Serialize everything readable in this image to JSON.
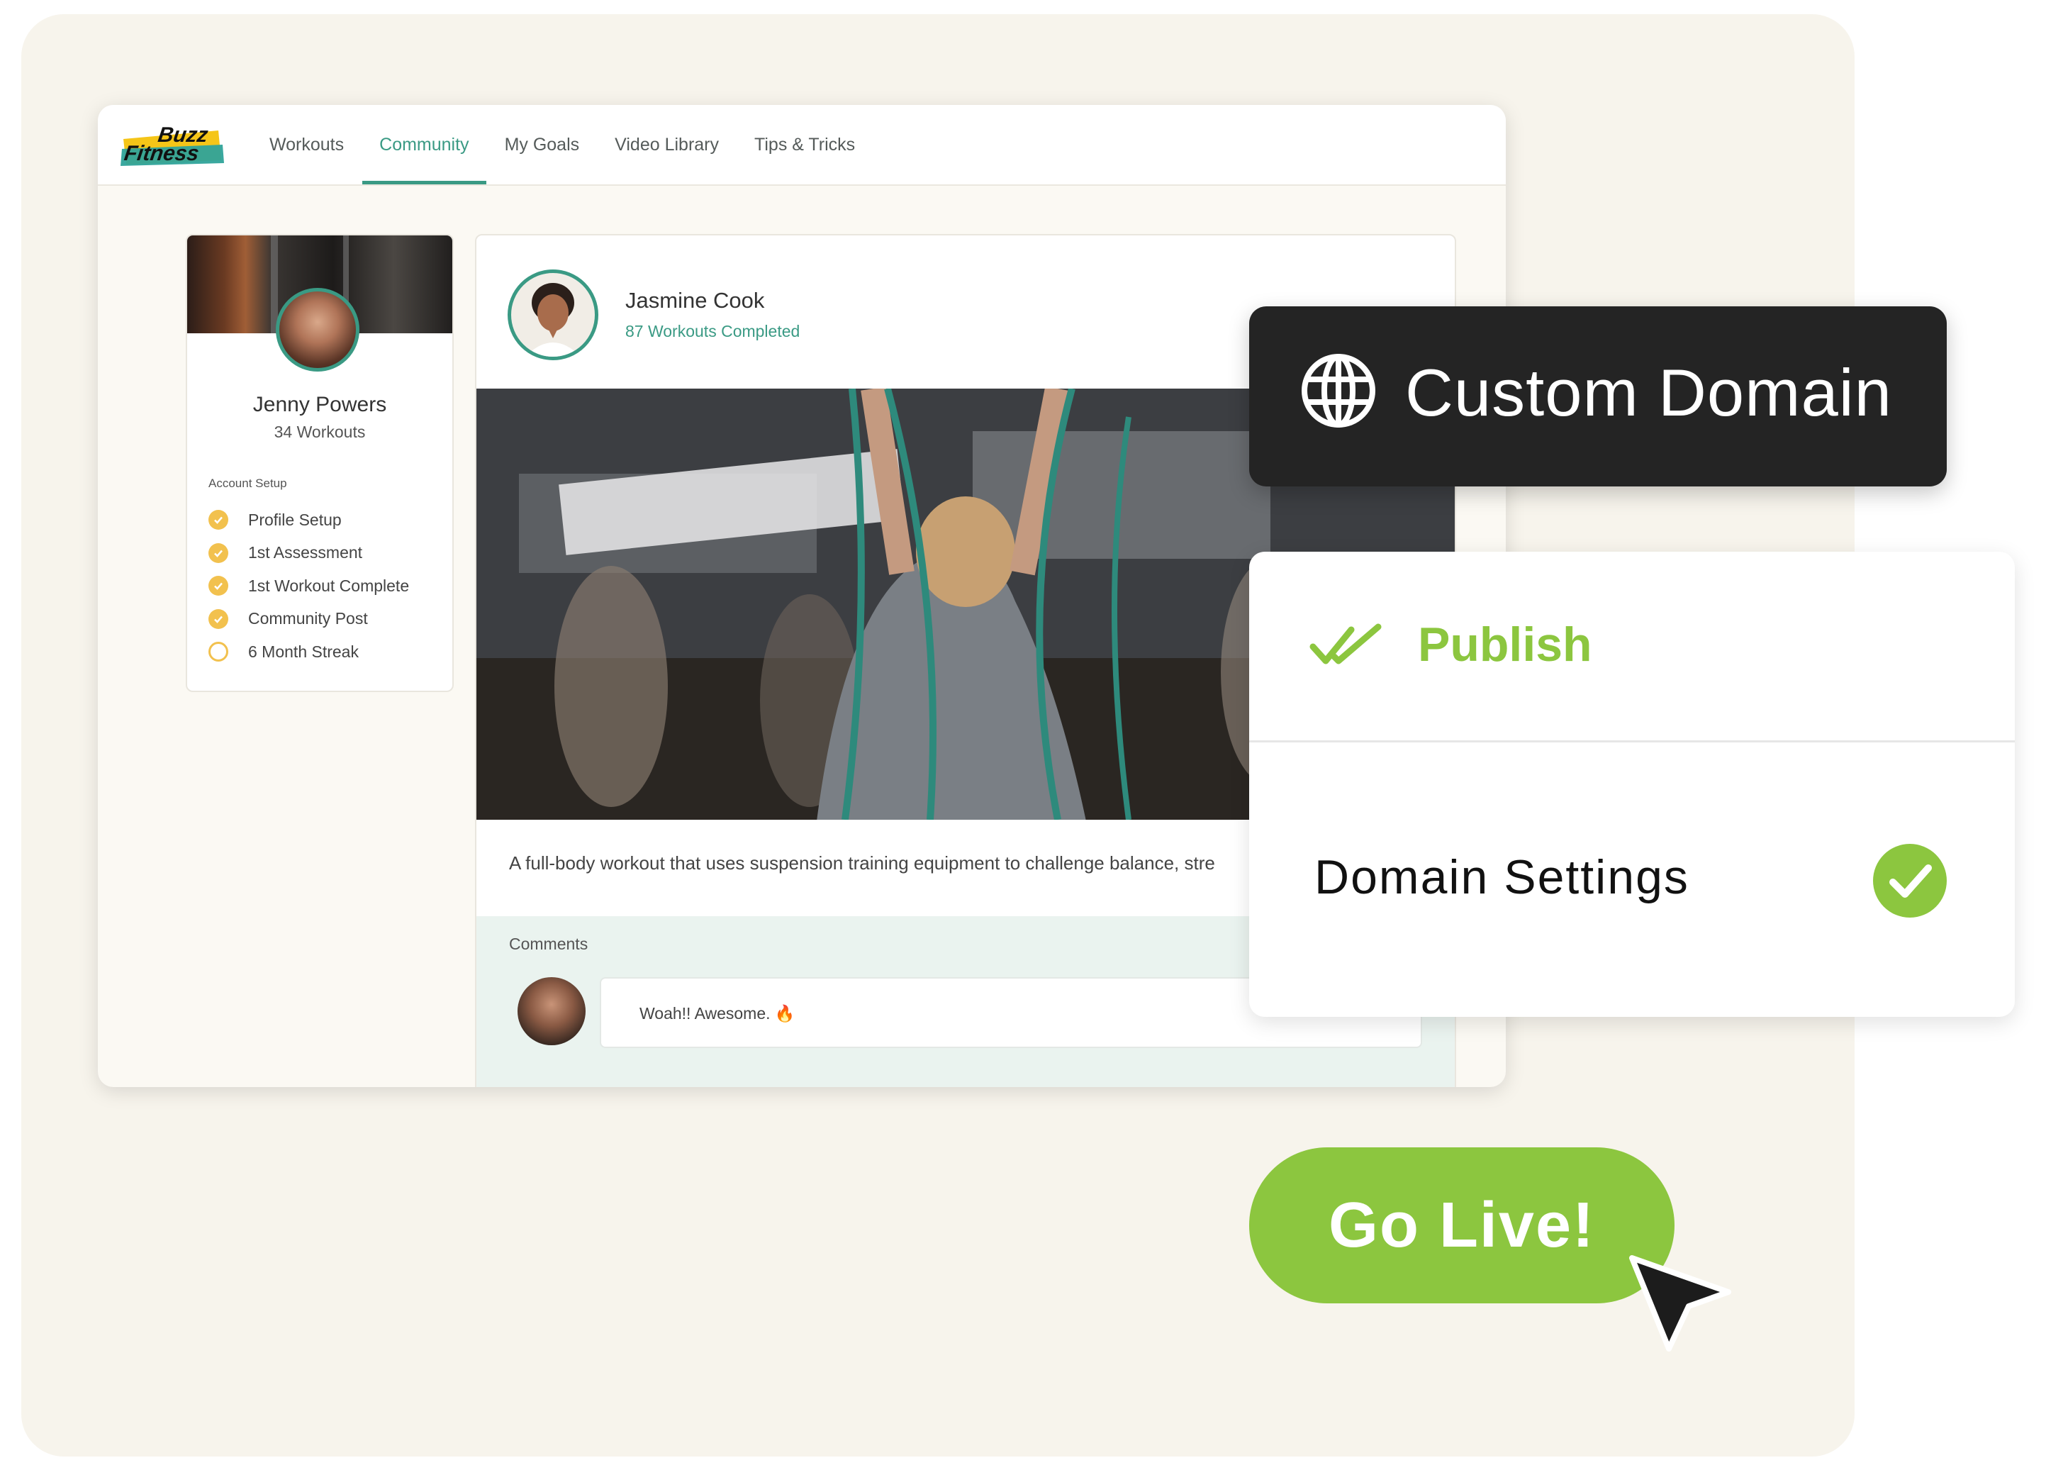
{
  "brand": {
    "logo_text_top": "Buzz",
    "logo_text_bottom": "Fitness",
    "logo_colors": [
      "#f5c518",
      "#2fa39a",
      "#111111"
    ]
  },
  "nav": {
    "items": [
      {
        "label": "Workouts",
        "active": false
      },
      {
        "label": "Community",
        "active": true
      },
      {
        "label": "My Goals",
        "active": false
      },
      {
        "label": "Video Library",
        "active": false
      },
      {
        "label": "Tips & Tricks",
        "active": false
      }
    ]
  },
  "profile": {
    "name": "Jenny Powers",
    "subtitle": "34 Workouts",
    "setup_title": "Account Setup",
    "checklist": [
      {
        "label": "Profile Setup",
        "done": true
      },
      {
        "label": "1st Assessment",
        "done": true
      },
      {
        "label": "1st Workout Complete",
        "done": true
      },
      {
        "label": "Community Post",
        "done": true
      },
      {
        "label": "6 Month Streak",
        "done": false
      }
    ]
  },
  "post": {
    "author": "Jasmine Cook",
    "author_sub": "87 Workouts Completed",
    "text": "A full-body workout that uses suspension training equipment to challenge balance, stre",
    "comments_label": "Comments",
    "comment": "Woah!! Awesome. 🔥"
  },
  "overlays": {
    "domain_title": "Custom Domain",
    "publish_label": "Publish",
    "settings_label": "Domain Settings",
    "go_live_label": "Go Live!"
  },
  "colors": {
    "accent_teal": "#3a9a84",
    "accent_green": "#8cc63f",
    "checklist_yellow": "#f2c14e",
    "dark_card": "#242424",
    "backdrop": "#f7f4ec"
  },
  "icons": [
    "globe-icon",
    "double-check-icon",
    "check-circle-icon",
    "cursor-icon",
    "check-icon",
    "fire-icon"
  ]
}
